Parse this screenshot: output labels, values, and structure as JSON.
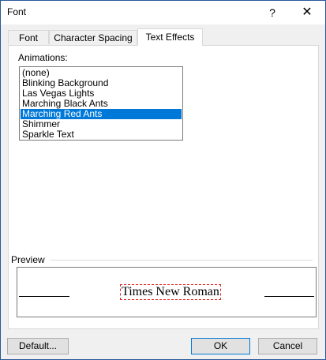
{
  "window": {
    "title": "Font",
    "help_label": "?",
    "close_label": "✕"
  },
  "tabs": [
    {
      "label": "Font",
      "active": false
    },
    {
      "label": "Character Spacing",
      "active": false
    },
    {
      "label": "Text Effects",
      "active": true
    }
  ],
  "animations": {
    "label": "Animations:",
    "selected": "Marching Red Ants",
    "items": [
      "(none)",
      "Blinking Background",
      "Las Vegas Lights",
      "Marching Black Ants",
      "Marching Red Ants",
      "Shimmer",
      "Sparkle Text"
    ]
  },
  "preview": {
    "label": "Preview",
    "sample_text": "Times New Roman",
    "effect_color": "#e01f1f"
  },
  "buttons": {
    "default_label": "Default...",
    "ok_label": "OK",
    "cancel_label": "Cancel"
  },
  "colors": {
    "selection": "#0078d7",
    "window_border": "#2b579a"
  }
}
